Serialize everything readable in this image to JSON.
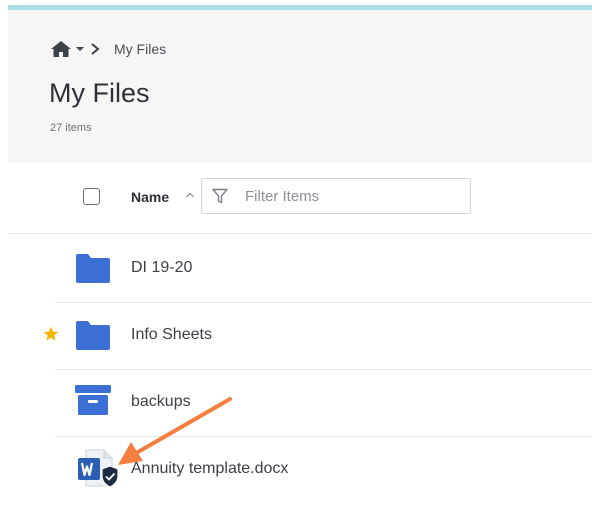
{
  "breadcrumb": {
    "current": "My Files"
  },
  "page": {
    "title": "My Files",
    "item_count": "27 items"
  },
  "list_header": {
    "column_name": "Name",
    "filter_placeholder": "Filter Items"
  },
  "rows": [
    {
      "label": "DI 19-20",
      "icon": "folder-icon",
      "starred": false
    },
    {
      "label": "Info Sheets",
      "icon": "folder-icon",
      "starred": true
    },
    {
      "label": "backups",
      "icon": "archive-box-icon",
      "starred": false
    },
    {
      "label": "Annuity template.docx",
      "icon": "word-document-icon",
      "starred": false
    }
  ],
  "colors": {
    "accent_bar": "#a9dfe3",
    "folder_blue": "#3b6fd4",
    "star": "#f4b400",
    "annotation_arrow": "#f47f3e",
    "word_blue": "#2b5fb3"
  }
}
